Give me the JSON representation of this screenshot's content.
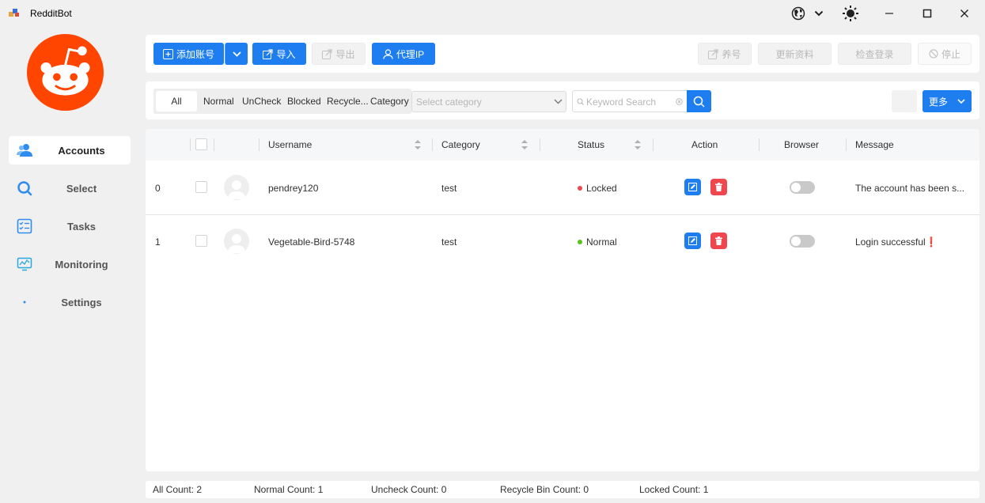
{
  "window": {
    "title": "RedditBot",
    "icons": [
      "app-icon",
      "globe-icon",
      "chevron-down-icon",
      "sun-icon",
      "minimize-icon",
      "maximize-icon",
      "close-icon"
    ]
  },
  "sidebar": {
    "items": [
      {
        "label": "Accounts",
        "icon": "users-icon",
        "active": true
      },
      {
        "label": "Select",
        "icon": "search-icon"
      },
      {
        "label": "Tasks",
        "icon": "checklist-icon"
      },
      {
        "label": "Monitoring",
        "icon": "monitor-icon"
      },
      {
        "label": "Settings",
        "icon": "dot-icon"
      }
    ]
  },
  "toolbar": {
    "add_account": "添加账号",
    "import": "导入",
    "export": "导出",
    "proxy_ip": "代理IP",
    "nurture": "养号",
    "update_profile": "更新资料",
    "check_login": "检查登录",
    "stop": "停止"
  },
  "filters": {
    "tabs": [
      "All",
      "Normal",
      "UnCheck",
      "Blocked",
      "Recycle...",
      "Category"
    ],
    "active_tab": "All",
    "category_placeholder": "Select category",
    "search_placeholder": "Keyword Search",
    "more": "更多"
  },
  "table": {
    "columns": [
      "Username",
      "Category",
      "Status",
      "Action",
      "Browser",
      "Message"
    ],
    "rows": [
      {
        "index": "0",
        "username": "pendrey120",
        "category": "test",
        "status": "Locked",
        "message": "The account has been s..."
      },
      {
        "index": "1",
        "username": "Vegetable-Bird-5748",
        "category": "test",
        "status": "Normal",
        "message": "Login successful❗"
      }
    ]
  },
  "status_bar": {
    "all": "All Count: 2",
    "normal": "Normal Count: 1",
    "uncheck": "Uncheck Count: 0",
    "recycle": "Recycle Bin Count: 0",
    "locked": "Locked Count: 1"
  },
  "colors": {
    "primary": "#1e7ef0",
    "danger": "#f0474f",
    "locked_dot": "#f0474f",
    "normal_dot": "#52c41a",
    "reddit_orange": "#ff4500"
  }
}
